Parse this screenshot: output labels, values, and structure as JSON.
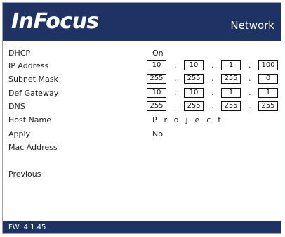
{
  "header": {
    "logo": "InFocus",
    "menu_title": "Network"
  },
  "menu": {
    "dhcp_label": "DHCP",
    "ip_label": "IP Address",
    "subnet_label": "Subnet Mask",
    "gateway_label": "Def Gateway",
    "dns_label": "DNS",
    "host_label": "Host Name",
    "apply_label": "Apply",
    "mac_label": "Mac Address",
    "previous_label": "Previous"
  },
  "values": {
    "dhcp": "On",
    "ip": [
      "10",
      "10",
      "1",
      "100"
    ],
    "subnet": [
      "255",
      "255",
      "255",
      "0"
    ],
    "gateway": [
      "10",
      "10",
      "1",
      "1"
    ],
    "dns": [
      "255",
      "255",
      "255",
      "255"
    ],
    "host_name": "Project",
    "apply": "No",
    "octet_separator": "."
  },
  "footer": {
    "firmware": "FW: 4.1.45"
  },
  "colors": {
    "header_bg": "#1f3264",
    "footer_bg": "#1f3264",
    "text": "#202020"
  }
}
